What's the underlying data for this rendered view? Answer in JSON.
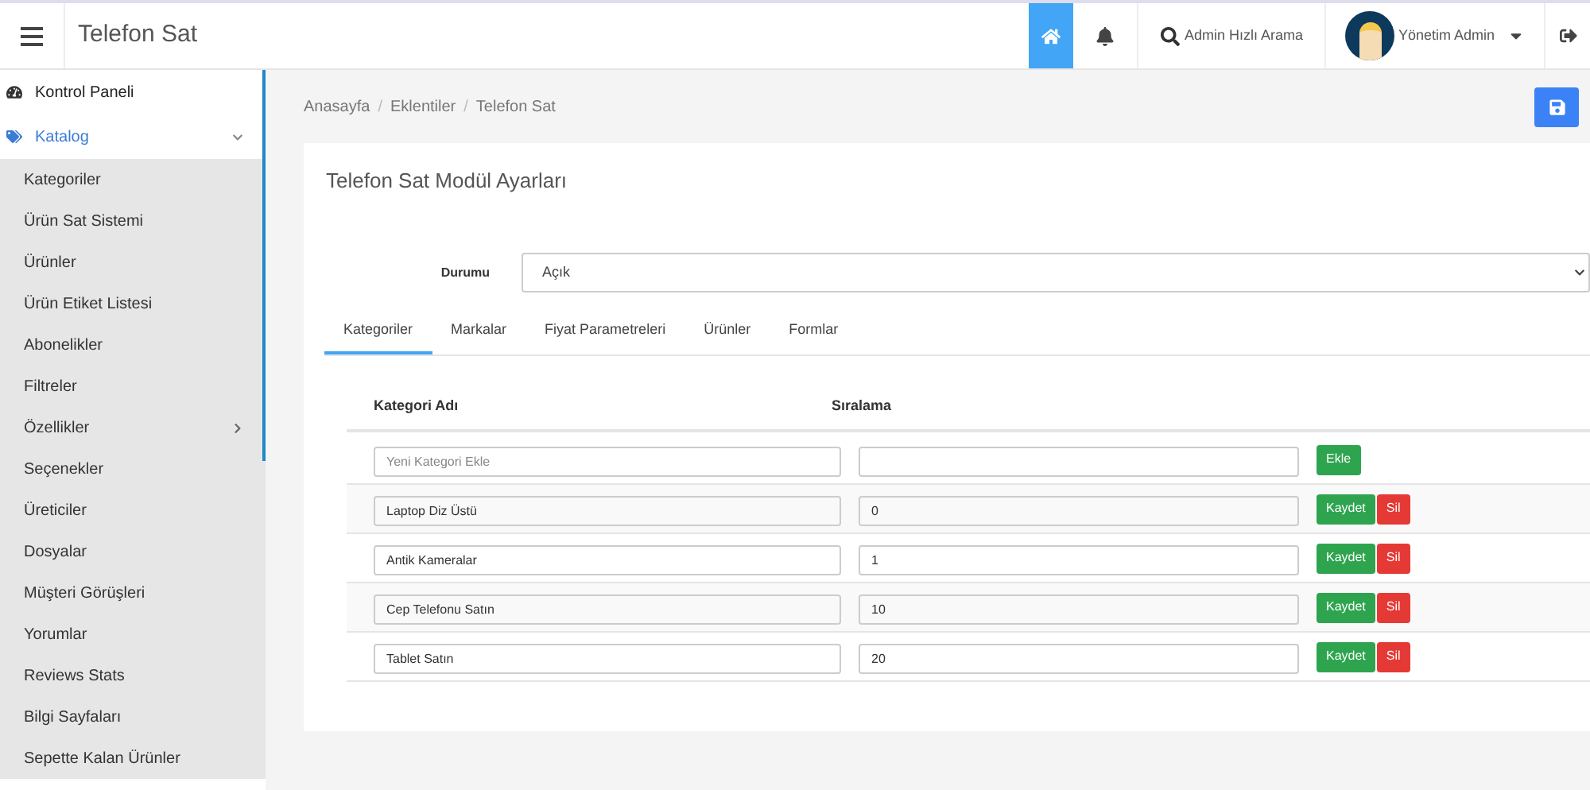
{
  "header": {
    "title": "Telefon Sat",
    "search_label": "Admin Hızlı Arama",
    "user_name": "Yönetim Admin"
  },
  "sidebar": {
    "items": [
      {
        "label": "Kontrol Paneli",
        "kind": "dashboard",
        "selected": false
      },
      {
        "label": "Katalog",
        "kind": "tag",
        "selected": true,
        "expanded": true,
        "children": [
          {
            "label": "Kategoriler"
          },
          {
            "label": "Ürün Sat Sistemi"
          },
          {
            "label": "Ürünler"
          },
          {
            "label": "Ürün Etiket Listesi"
          },
          {
            "label": "Abonelikler"
          },
          {
            "label": "Filtreler"
          },
          {
            "label": "Özellikler",
            "expanded": false
          },
          {
            "label": "Seçenekler"
          },
          {
            "label": "Üreticiler"
          },
          {
            "label": "Dosyalar"
          },
          {
            "label": "Müşteri Görüşleri"
          },
          {
            "label": "Yorumlar"
          },
          {
            "label": "Reviews Stats"
          },
          {
            "label": "Bilgi Sayfaları"
          },
          {
            "label": "Sepette Kalan Ürünler"
          }
        ]
      }
    ]
  },
  "breadcrumb": {
    "separator": "/",
    "items": [
      "Anasayfa",
      "Eklentiler",
      "Telefon Sat"
    ]
  },
  "card": {
    "title": "Telefon Sat Modül Ayarları",
    "status_label": "Durumu",
    "status_value": "Açık",
    "tabs": [
      {
        "label": "Kategoriler",
        "selected": true
      },
      {
        "label": "Markalar",
        "selected": false
      },
      {
        "label": "Fiyat Parametreleri",
        "selected": false
      },
      {
        "label": "Ürünler",
        "selected": false
      },
      {
        "label": "Formlar",
        "selected": false
      }
    ],
    "table": {
      "columns": [
        "Kategori Adı",
        "Sıralama"
      ],
      "rows": [
        {
          "kind": "new",
          "name_placeholder": "Yeni Kategori Ekle",
          "buttons": [
            "Ekle"
          ]
        },
        {
          "kind": "item",
          "name": "Laptop Diz Üstü",
          "order": "0",
          "buttons": [
            "Kaydet",
            "Sil"
          ]
        },
        {
          "kind": "item",
          "name": "Antik Kameralar",
          "order": "1",
          "buttons": [
            "Kaydet",
            "Sil"
          ]
        },
        {
          "kind": "item",
          "name": "Cep Telefonu Satın",
          "order": "10",
          "buttons": [
            "Kaydet",
            "Sil"
          ]
        },
        {
          "kind": "item",
          "name": "Tablet Satın",
          "order": "20",
          "buttons": [
            "Kaydet",
            "Sil"
          ]
        }
      ]
    }
  }
}
